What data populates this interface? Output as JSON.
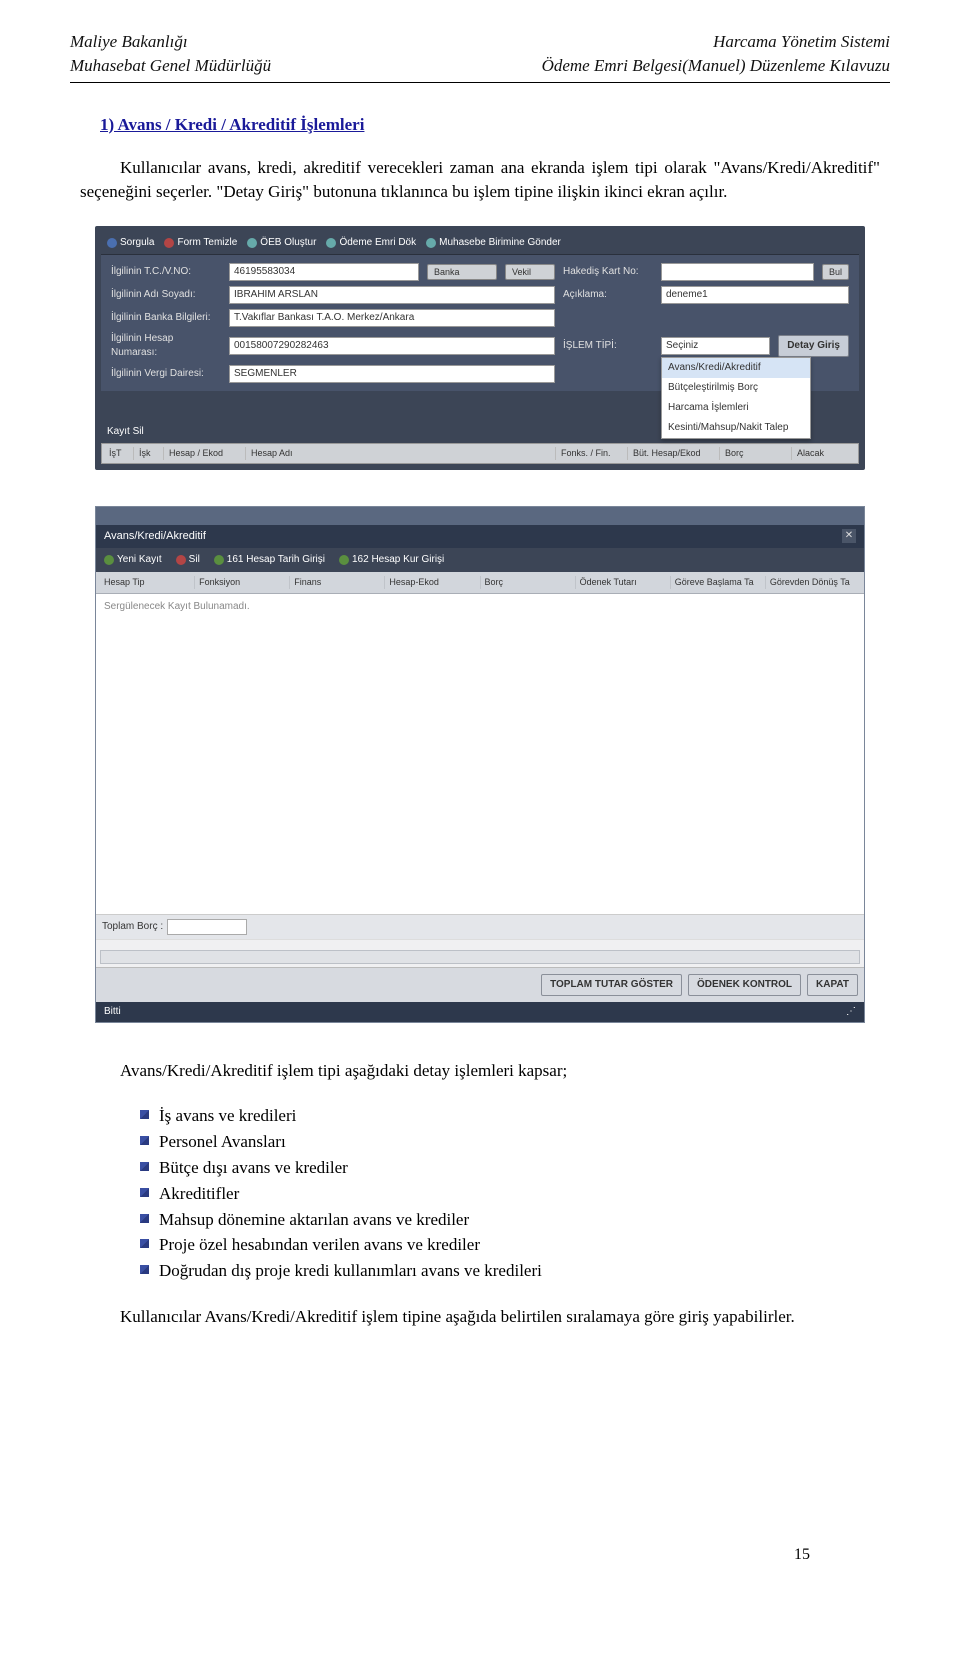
{
  "header": {
    "left1": "Maliye Bakanlığı",
    "left2": "Muhasebat Genel Müdürlüğü",
    "right1": "Harcama Yönetim Sistemi",
    "right2": "Ödeme Emri Belgesi(Manuel) Düzenleme Kılavuzu"
  },
  "title": "1)  Avans / Kredi / Akreditif İşlemleri",
  "paragraph1": "Kullanıcılar avans, kredi, akreditif verecekleri zaman ana ekranda işlem tipi olarak \"Avans/Kredi/Akreditif\" seçeneğini seçerler. \"Detay Giriş\" butonuna tıklanınca bu işlem tipine ilişkin ikinci ekran açılır.",
  "paragraph2": "Avans/Kredi/Akreditif işlem tipi aşağıdaki detay işlemleri kapsar;",
  "bullets": [
    "İş avans ve kredileri",
    "Personel Avansları",
    "Bütçe dışı avans ve krediler",
    "Akreditifler",
    "Mahsup dönemine aktarılan avans ve krediler",
    "Proje özel hesabından verilen avans ve krediler",
    "Doğrudan dış proje kredi kullanımları avans ve kredileri"
  ],
  "paragraph3": "Kullanıcılar Avans/Kredi/Akreditif işlem tipine aşağıda belirtilen sıralamaya göre giriş yapabilirler.",
  "pagenum": "15",
  "s1": {
    "toolbar": {
      "sorgula": "Sorgula",
      "form_temizle": "Form Temizle",
      "oeb": "ÖEB Oluştur",
      "odeme": "Ödeme Emri Dök",
      "gonder": "Muhasebe Birimine Gönder"
    },
    "labels": {
      "tcvno": "İlgilinin T.C./V.NO:",
      "adsoy": "İlgilinin Adı Soyadı:",
      "banka": "İlgilinin Banka Bilgileri:",
      "hesap": "İlgilinin Hesap Numarası:",
      "vergi": "İlgilinin Vergi Dairesi:",
      "hakedis": "Hakediş Kart No:",
      "aciklama": "Açıklama:",
      "islem": "İŞLEM TİPİ:"
    },
    "vals": {
      "tcvno": "46195583034",
      "adsoy": "İBRAHİM ARSLAN",
      "banka": "T.Vakıflar Bankası T.A.O. Merkez/Ankara",
      "hesap": "00158007290282463",
      "vergi": "SEĞMENLER",
      "aciklama": "deneme1",
      "secin": "Seçiniz"
    },
    "buttons": {
      "banka": "Banka",
      "vekil": "Vekil",
      "bul": "Bul",
      "detay": "Detay Giriş"
    },
    "dropdown": [
      "Avans/Kredi/Akreditif",
      "Bütçeleştirilmiş Borç",
      "Harcama İşlemleri",
      "Kesinti/Mahsup/Nakit Talep"
    ],
    "kayit_sil": "Kayıt Sil",
    "cols": [
      "İşT",
      "İşk",
      "Hesap / Ekod",
      "Hesap Adı",
      "Fonks. / Fin.",
      "Büt. Hesap/Ekod",
      "Borç",
      "Alacak"
    ]
  },
  "s2": {
    "title": "Avans/Kredi/Akreditif",
    "toolbar": {
      "yeni": "Yeni Kayıt",
      "sil": "Sil",
      "h161": "161 Hesap Tarih Girişi",
      "h162": "162 Hesap Kur Girişi"
    },
    "cols": [
      "Hesap Tip",
      "Fonksiyon",
      "Finans",
      "Hesap-Ekod",
      "Borç",
      "Ödenek Tutarı",
      "Göreve Başlama Ta",
      "Görevden Dönüş Ta"
    ],
    "body_msg": "Sergülenecek Kayıt Bulunamadı.",
    "toplam": "Toplam Borç :",
    "btns": {
      "tutar": "TOPLAM TUTAR GÖSTER",
      "odenek": "ÖDENEK KONTROL",
      "kapat": "KAPAT"
    },
    "status": "Bitti"
  }
}
